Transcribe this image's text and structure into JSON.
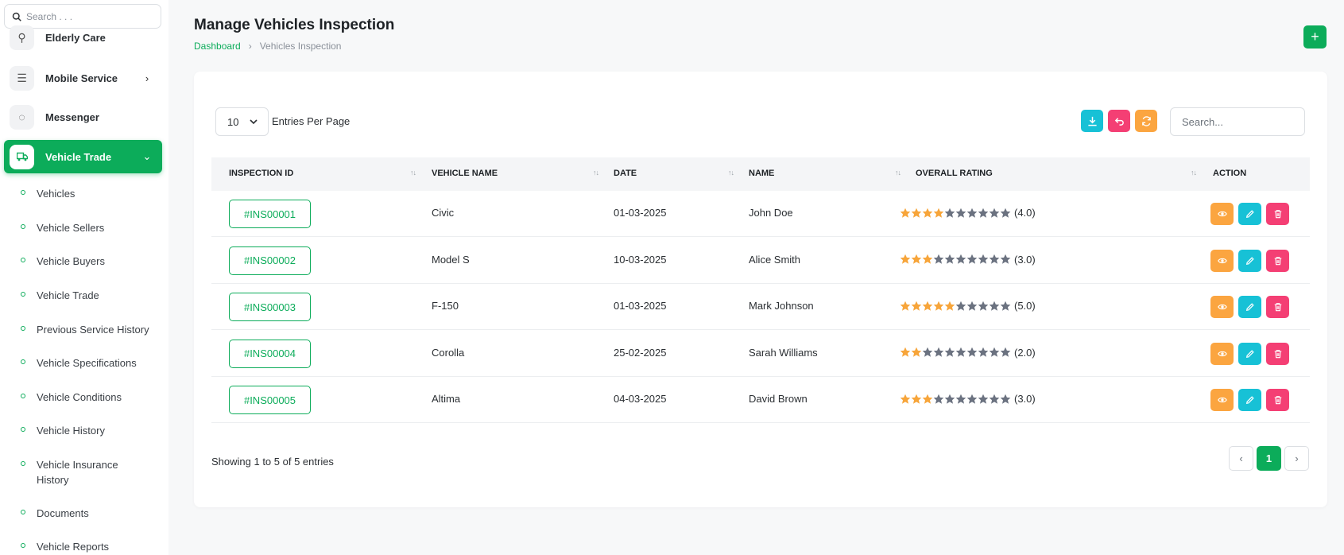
{
  "sidebar": {
    "search_placeholder": "Search . . .",
    "items": [
      {
        "label": "Elderly Care",
        "icon": "elderly-icon"
      },
      {
        "label": "Mobile Service",
        "icon": "menu-icon"
      },
      {
        "label": "Messenger",
        "icon": "chat-icon"
      },
      {
        "label": "Vehicle Trade",
        "icon": "truck-icon",
        "active": true
      }
    ],
    "subitems": [
      "Vehicles",
      "Vehicle Sellers",
      "Vehicle Buyers",
      "Vehicle Trade",
      "Previous Service History",
      "Vehicle Specifications",
      "Vehicle Conditions",
      "Vehicle History",
      "Vehicle Insurance History",
      "Documents",
      "Vehicle Reports"
    ]
  },
  "header": {
    "title": "Manage Vehicles Inspection",
    "breadcrumb": {
      "home": "Dashboard",
      "current": "Vehicles Inspection"
    },
    "add_label": "+"
  },
  "toolbar": {
    "entries_value": "10",
    "entries_label": "Entries Per Page",
    "search_placeholder": "Search..."
  },
  "table": {
    "columns": [
      "INSPECTION ID",
      "VEHICLE NAME",
      "DATE",
      "NAME",
      "OVERALL RATING",
      "ACTION"
    ],
    "rows": [
      {
        "id": "#INS00001",
        "vehicle": "Civic",
        "date": "01-03-2025",
        "name": "John Doe",
        "rating": 4,
        "rating_text": "(4.0)"
      },
      {
        "id": "#INS00002",
        "vehicle": "Model S",
        "date": "10-03-2025",
        "name": "Alice Smith",
        "rating": 3,
        "rating_text": "(3.0)"
      },
      {
        "id": "#INS00003",
        "vehicle": "F-150",
        "date": "01-03-2025",
        "name": "Mark Johnson",
        "rating": 5,
        "rating_text": "(5.0)"
      },
      {
        "id": "#INS00004",
        "vehicle": "Corolla",
        "date": "25-02-2025",
        "name": "Sarah Williams",
        "rating": 2,
        "rating_text": "(2.0)"
      },
      {
        "id": "#INS00005",
        "vehicle": "Altima",
        "date": "04-03-2025",
        "name": "David Brown",
        "rating": 3,
        "rating_text": "(3.0)"
      }
    ],
    "max_rating": 10
  },
  "footer": {
    "showing": "Showing 1 to 5 of 5 entries",
    "page": "1"
  },
  "colors": {
    "primary": "#0cac5a",
    "cyan": "#17c1d6",
    "pink": "#f43f74",
    "orange": "#fba540",
    "star_filled": "#f7a53a",
    "star_empty": "#6b7280"
  }
}
